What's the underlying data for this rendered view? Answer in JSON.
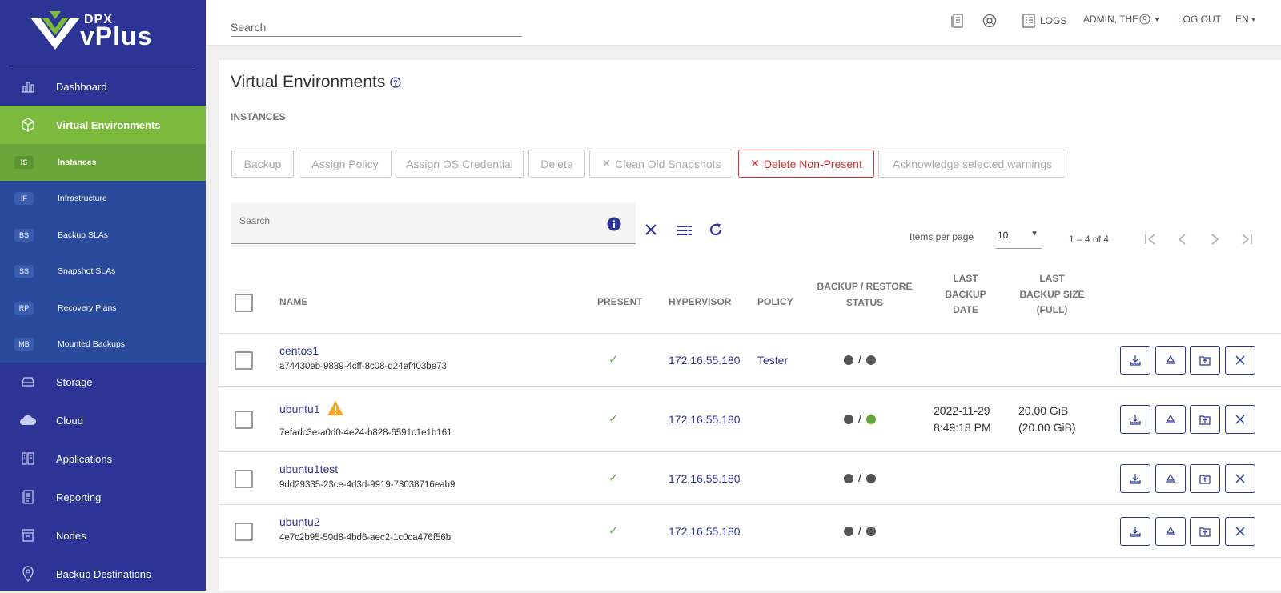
{
  "brand": {
    "top": "DPX",
    "bottom": "vPlus"
  },
  "sidebar": {
    "items": [
      {
        "label": "Dashboard",
        "icon": "bar-chart-icon"
      },
      {
        "label": "Virtual Environments",
        "icon": "cube-icon",
        "active": true
      }
    ],
    "subitems": [
      {
        "abbr": "IS",
        "label": "Instances",
        "active": true
      },
      {
        "abbr": "IF",
        "label": "Infrastructure"
      },
      {
        "abbr": "BS",
        "label": "Backup SLAs"
      },
      {
        "abbr": "SS",
        "label": "Snapshot SLAs"
      },
      {
        "abbr": "RP",
        "label": "Recovery Plans"
      },
      {
        "abbr": "MB",
        "label": "Mounted Backups"
      }
    ],
    "lower": [
      {
        "label": "Storage",
        "icon": "storage-icon"
      },
      {
        "label": "Cloud",
        "icon": "cloud-icon"
      },
      {
        "label": "Applications",
        "icon": "applications-icon"
      },
      {
        "label": "Reporting",
        "icon": "reporting-icon"
      },
      {
        "label": "Nodes",
        "icon": "nodes-icon"
      },
      {
        "label": "Backup Destinations",
        "icon": "location-pin-icon"
      }
    ]
  },
  "topbar": {
    "search_placeholder": "Search",
    "logs": "LOGS",
    "user": "ADMIN, THE",
    "logout": "LOG OUT",
    "lang": "EN"
  },
  "page": {
    "title": "Virtual Environments",
    "section": "INSTANCES"
  },
  "actions": {
    "backup": "Backup",
    "assign_policy": "Assign Policy",
    "assign_os": "Assign OS Credential",
    "delete": "Delete",
    "clean": "Clean Old Snapshots",
    "delete_np": "Delete Non-Present",
    "ack": "Acknowledge selected warnings"
  },
  "filter": {
    "placeholder": "Search"
  },
  "pager": {
    "items_label": "Items per page",
    "per_page": "10",
    "range": "1 – 4 of 4"
  },
  "table": {
    "headers": {
      "name": "NAME",
      "present": "PRESENT",
      "hypervisor": "HYPERVISOR",
      "policy": "POLICY",
      "status_1": "BACKUP / RESTORE",
      "status_2": "STATUS",
      "lbd_1": "LAST",
      "lbd_2": "BACKUP",
      "lbd_3": "DATE",
      "lbs_1": "LAST",
      "lbs_2": "BACKUP SIZE",
      "lbs_3": "(FULL)"
    },
    "rows": [
      {
        "name": "centos1",
        "uuid": "a74430eb-9889-4cff-8c08-d24ef403be73",
        "present": "✓",
        "hypervisor": "172.16.55.180",
        "policy": "Tester",
        "sep": "/",
        "date1": "",
        "date2": "",
        "size1": "",
        "size2": ""
      },
      {
        "name": "ubuntu1",
        "uuid": "7efadc3e-a0d0-4e24-b828-6591c1e1b161",
        "present": "✓",
        "hypervisor": "172.16.55.180",
        "policy": "",
        "sep": "/",
        "date1": "2022-11-29",
        "date2": "8:49:18 PM",
        "size1": "20.00 GiB",
        "size2": "(20.00 GiB)",
        "warning": true
      },
      {
        "name": "ubuntu1test",
        "uuid": "9dd29335-23ce-4d3d-9919-73038716eab9",
        "present": "✓",
        "hypervisor": "172.16.55.180",
        "policy": "",
        "sep": "/",
        "date1": "",
        "date2": "",
        "size1": "",
        "size2": ""
      },
      {
        "name": "ubuntu2",
        "uuid": "4e7c2b95-50d8-4bd6-aec2-1c0ca476f56b",
        "present": "✓",
        "hypervisor": "172.16.55.180",
        "policy": "",
        "sep": "/",
        "date1": "",
        "date2": "",
        "size1": "",
        "size2": ""
      }
    ]
  },
  "colors": {
    "sidebar": "#2c3596",
    "active": "#7cba3e",
    "danger": "#d32f2f"
  }
}
